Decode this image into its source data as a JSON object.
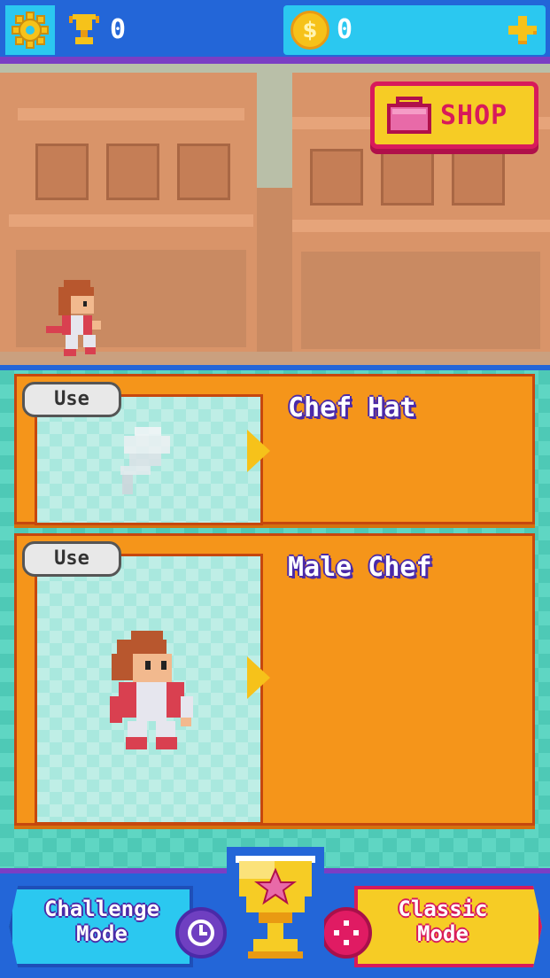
{
  "topbar": {
    "settings_icon": "gear-icon",
    "trophy_count": "0",
    "coin_symbol": "$",
    "coin_count": "0",
    "add_coins_icon": "plus-icon"
  },
  "scene": {
    "shop_label": "SHOP",
    "shop_icon": "shopping-bag-icon"
  },
  "items": [
    {
      "use_label": "Use",
      "name": "Chef Hat"
    },
    {
      "use_label": "Use",
      "name": "Male Chef"
    }
  ],
  "bottom": {
    "challenge_line1": "Challenge",
    "challenge_line2": "Mode",
    "classic_line1": "Classic",
    "classic_line2": "Mode",
    "center_icon": "trophy-star-icon"
  },
  "colors": {
    "topbar": "#2366d8",
    "accent_cyan": "#2bc8f0",
    "card_orange": "#f5951a",
    "shop_yellow": "#f6cc25",
    "shop_pink": "#d81a5b",
    "background_teal": "#4ec9b6"
  }
}
